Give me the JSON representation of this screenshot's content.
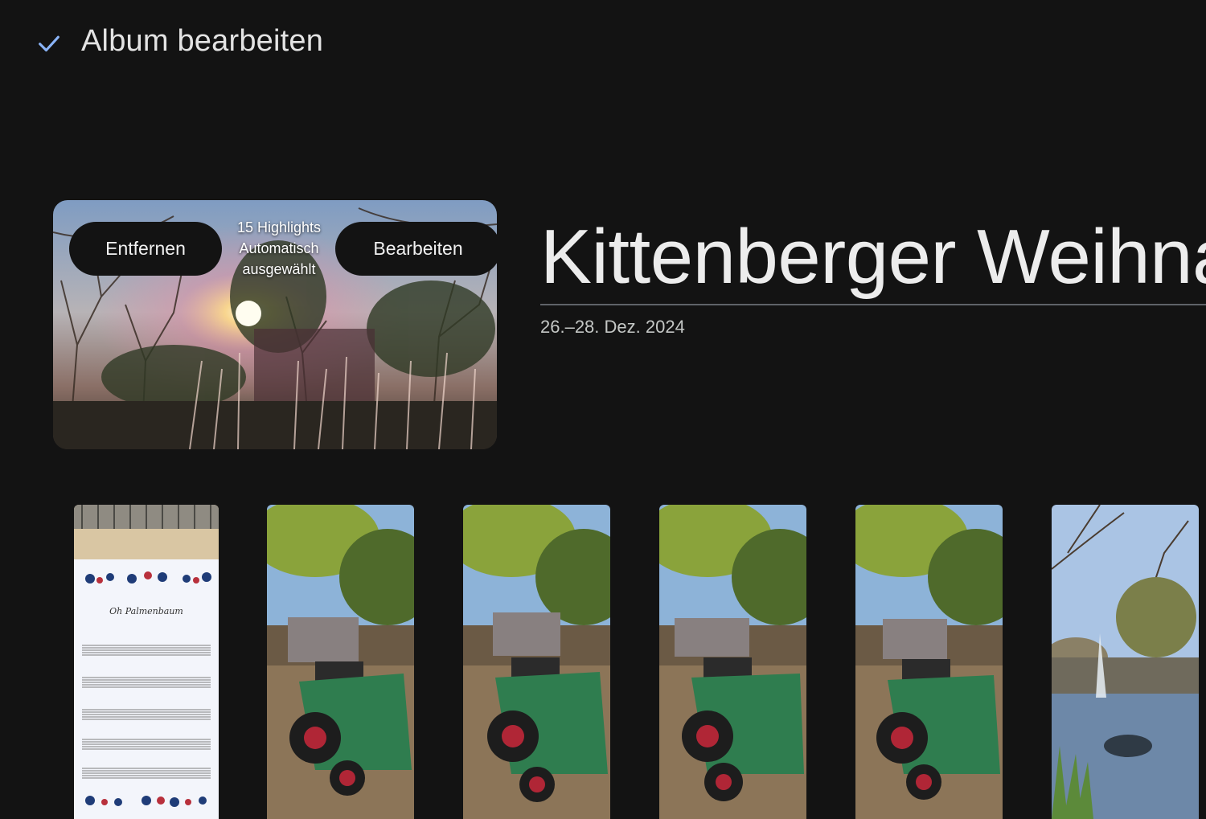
{
  "header": {
    "done_icon": "check-icon",
    "title": "Album bearbeiten"
  },
  "cover": {
    "remove_label": "Entfernen",
    "edit_label": "Bearbeiten",
    "highlights_line1": "15 Highlights",
    "highlights_line2": "Automatisch",
    "highlights_line3": "ausgewählt"
  },
  "album": {
    "title": "Kittenberger Weihnachten",
    "date": "26.–28. Dez. 2024"
  },
  "sheet_music": {
    "song_title": "Oh Palmenbaum"
  },
  "colors": {
    "background": "#131313",
    "accent_check": "#8ab4f8",
    "text_primary": "#e3e3e3",
    "text_secondary": "#c4c7c5"
  }
}
